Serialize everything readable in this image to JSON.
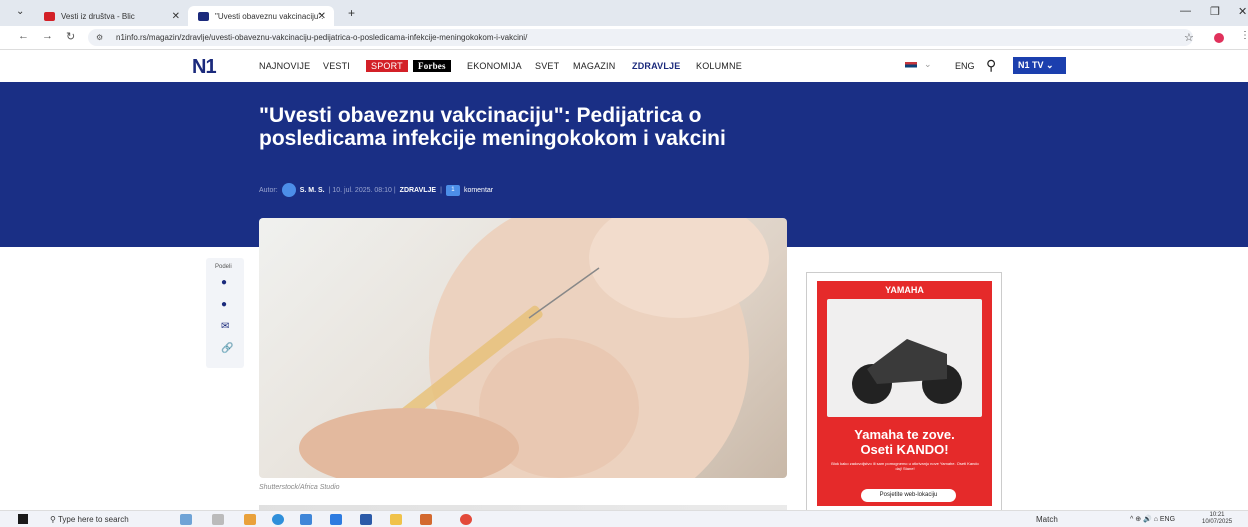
{
  "browser": {
    "tabs": [
      {
        "title": "Vesti iz društva - Blic",
        "favicon": "Blic",
        "favicon_color": "#d32027"
      },
      {
        "title": "\"Uvesti obaveznu vakcinaciju\": ",
        "favicon": "N1",
        "favicon_color": "#1b2a7c"
      }
    ],
    "url": "n1info.rs/magazin/zdravlje/uvesti-obaveznu-vakcinaciju-pedijatrica-o-posledicama-infekcije-meningokokom-i-vakcini/"
  },
  "site": {
    "logo": "N1",
    "menu": [
      "NAJNOVIJE",
      "VESTI",
      "SPORT",
      "Forbes",
      "EKONOMIJA",
      "SVET",
      "MAGAZIN",
      "ZDRAVLJE",
      "KOLUMNE"
    ],
    "lang": "ENG",
    "n1tv": "N1 TV"
  },
  "article": {
    "headline": "\"Uvesti obaveznu vakcinaciju\": Pedijatrica o posledicama infekcije meningokokom i vakcini",
    "byline": {
      "prefix": "Autor:",
      "author": "S. M. S.",
      "date": "| 10. jul. 2025. 08:10 |",
      "category": "ZDRAVLJE",
      "comment_count": "1",
      "comments_label": "komentar"
    },
    "image_caption": "Shutterstock/Africa Studio",
    "share_label": "Podeli"
  },
  "ad": {
    "brand": "YAMAHA",
    "title_line1": "Yamaha te zove.",
    "title_line2": "Oseti KANDO!",
    "body": "Blok kako zadovoljstvo ili sam pomognemo u otkrivanju nove Yamahe. Oseti Kando daj! Stane!",
    "button": "Posjetite web-lokaciju"
  },
  "taskbar": {
    "search_placeholder": "Type here to search",
    "weather": "Match",
    "lang": "ENG",
    "time": "10:21",
    "date": "10/07/2025"
  }
}
